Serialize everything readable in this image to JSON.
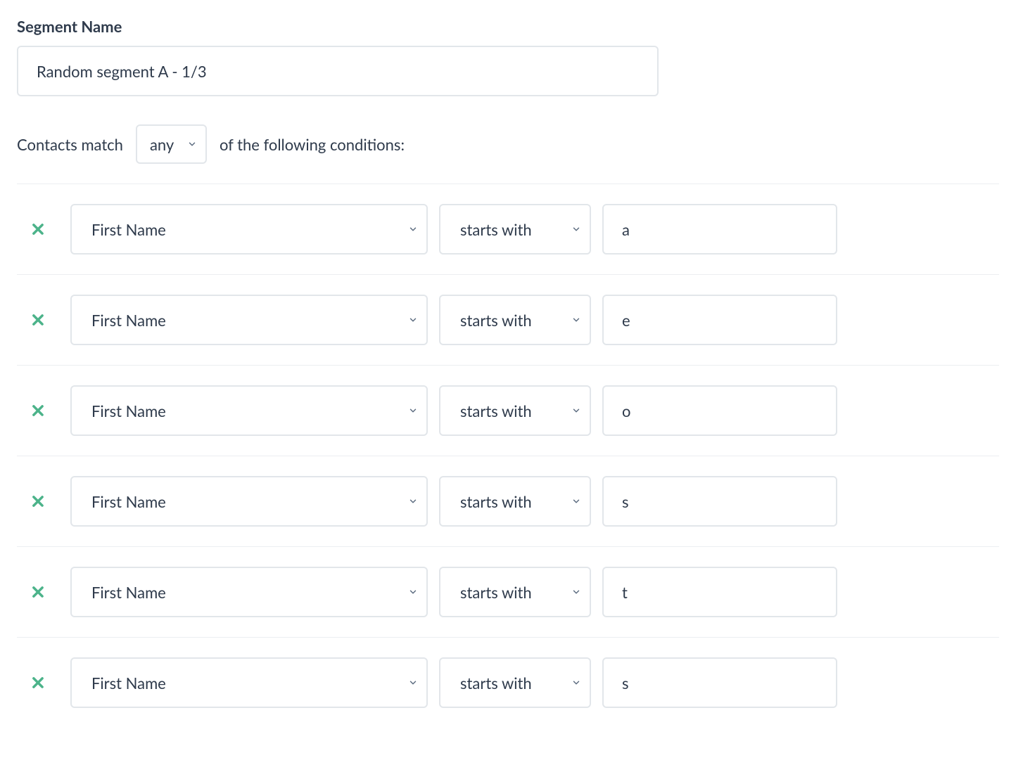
{
  "segment_name_label": "Segment Name",
  "segment_name_value": "Random segment A - 1/3",
  "match_prefix": "Contacts match",
  "match_mode": "any",
  "match_suffix": "of the following conditions:",
  "conditions": [
    {
      "field": "First Name",
      "operator": "starts with",
      "value": "a"
    },
    {
      "field": "First Name",
      "operator": "starts with",
      "value": "e"
    },
    {
      "field": "First Name",
      "operator": "starts with",
      "value": "o"
    },
    {
      "field": "First Name",
      "operator": "starts with",
      "value": "s"
    },
    {
      "field": "First Name",
      "operator": "starts with",
      "value": "t"
    },
    {
      "field": "First Name",
      "operator": "starts with",
      "value": "s"
    }
  ]
}
